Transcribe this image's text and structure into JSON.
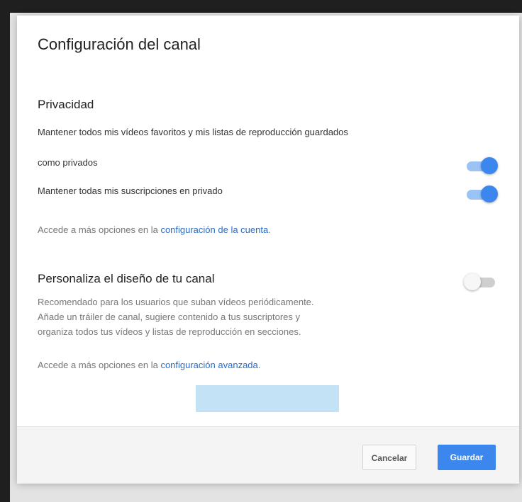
{
  "dialog": {
    "title": "Configuración del canal",
    "privacy": {
      "heading": "Privacidad",
      "favorites_line1": "Mantener todos mis vídeos favoritos y mis listas de reproducción guardados",
      "favorites_line2": "como privados",
      "favorites_toggle_on": true,
      "subscriptions_label": "Mantener todas mis suscripciones en privado",
      "subscriptions_toggle_on": true,
      "account_hint_prefix": "Accede a más opciones en la ",
      "account_hint_link": "configuración de la cuenta",
      "account_hint_suffix": "."
    },
    "layout": {
      "heading": "Personaliza el diseño de tu canal",
      "toggle_on": false,
      "description_line1": "Recomendado para los usuarios que suban vídeos periódicamente.",
      "description_line2": "Añade un tráiler de canal, sugiere contenido a tus suscriptores y",
      "description_line3": "organiza todos tus vídeos y listas de reproducción en secciones.",
      "advanced_hint_prefix": "Accede a más opciones en la ",
      "advanced_hint_link": "configuración avanzada",
      "advanced_hint_suffix": "."
    },
    "footer": {
      "cancel_label": "Cancelar",
      "save_label": "Guardar"
    }
  },
  "colors": {
    "accent": "#3b87ee",
    "link": "#2b6cc4",
    "highlight": "#c3e2f6"
  }
}
